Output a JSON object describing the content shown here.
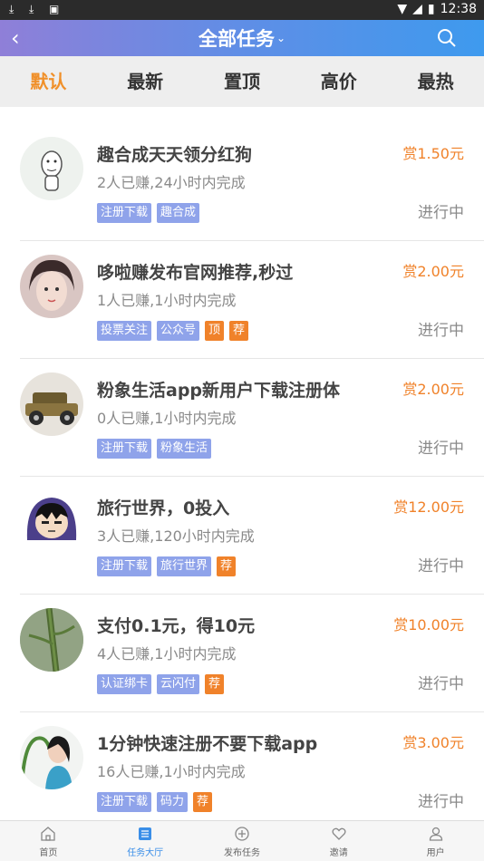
{
  "status_bar": {
    "time": "12:38"
  },
  "nav": {
    "title": "全部任务",
    "title_chevron": "⌄",
    "back_icon": "back-chevron",
    "search_icon": "search-icon"
  },
  "tabs": [
    {
      "label": "默认",
      "active": true
    },
    {
      "label": "最新",
      "active": false
    },
    {
      "label": "置顶",
      "active": false
    },
    {
      "label": "高价",
      "active": false
    },
    {
      "label": "最热",
      "active": false
    }
  ],
  "tasks": [
    {
      "title": "趣合成天天领分红狗",
      "sub": "2人已赚,24小时内完成",
      "tags": [
        "注册下载",
        "趣合成"
      ],
      "badges": [],
      "reward": "赏1.50元",
      "status": "进行中"
    },
    {
      "title": "哆啦赚发布官网推荐,秒过",
      "sub": "1人已赚,1小时内完成",
      "tags": [
        "投票关注",
        "公众号"
      ],
      "badges": [
        "顶",
        "荐"
      ],
      "reward": "赏2.00元",
      "status": "进行中"
    },
    {
      "title": "粉象生活app新用户下载注册体",
      "sub": "0人已赚,1小时内完成",
      "tags": [
        "注册下载",
        "粉象生活"
      ],
      "badges": [],
      "reward": "赏2.00元",
      "status": "进行中"
    },
    {
      "title": "旅行世界，0投入",
      "sub": "3人已赚,120小时内完成",
      "tags": [
        "注册下载",
        "旅行世界"
      ],
      "badges": [
        "荐"
      ],
      "reward": "赏12.00元",
      "status": "进行中"
    },
    {
      "title": "支付0.1元，得10元",
      "sub": "4人已赚,1小时内完成",
      "tags": [
        "认证绑卡",
        "云闪付"
      ],
      "badges": [
        "荐"
      ],
      "reward": "赏10.00元",
      "status": "进行中"
    },
    {
      "title": "1分钟快速注册不要下载app",
      "sub": "16人已赚,1小时内完成",
      "tags": [
        "注册下载",
        "码力"
      ],
      "badges": [
        "荐"
      ],
      "reward": "赏3.00元",
      "status": "进行中"
    }
  ],
  "bottom_nav": [
    {
      "label": "首页",
      "icon": "home-icon",
      "active": false
    },
    {
      "label": "任务大厅",
      "icon": "task-list-icon",
      "active": true
    },
    {
      "label": "发布任务",
      "icon": "plus-circle-icon",
      "active": false
    },
    {
      "label": "邀请",
      "icon": "heart-icon",
      "active": false
    },
    {
      "label": "用户",
      "icon": "user-icon",
      "active": false
    }
  ],
  "colors": {
    "accent": "#f0822a",
    "tag_blue": "#8fa3ea",
    "active_tab": "#f0902a",
    "nav_gradient_start": "#8f7fd8",
    "nav_gradient_end": "#3e9aee"
  }
}
